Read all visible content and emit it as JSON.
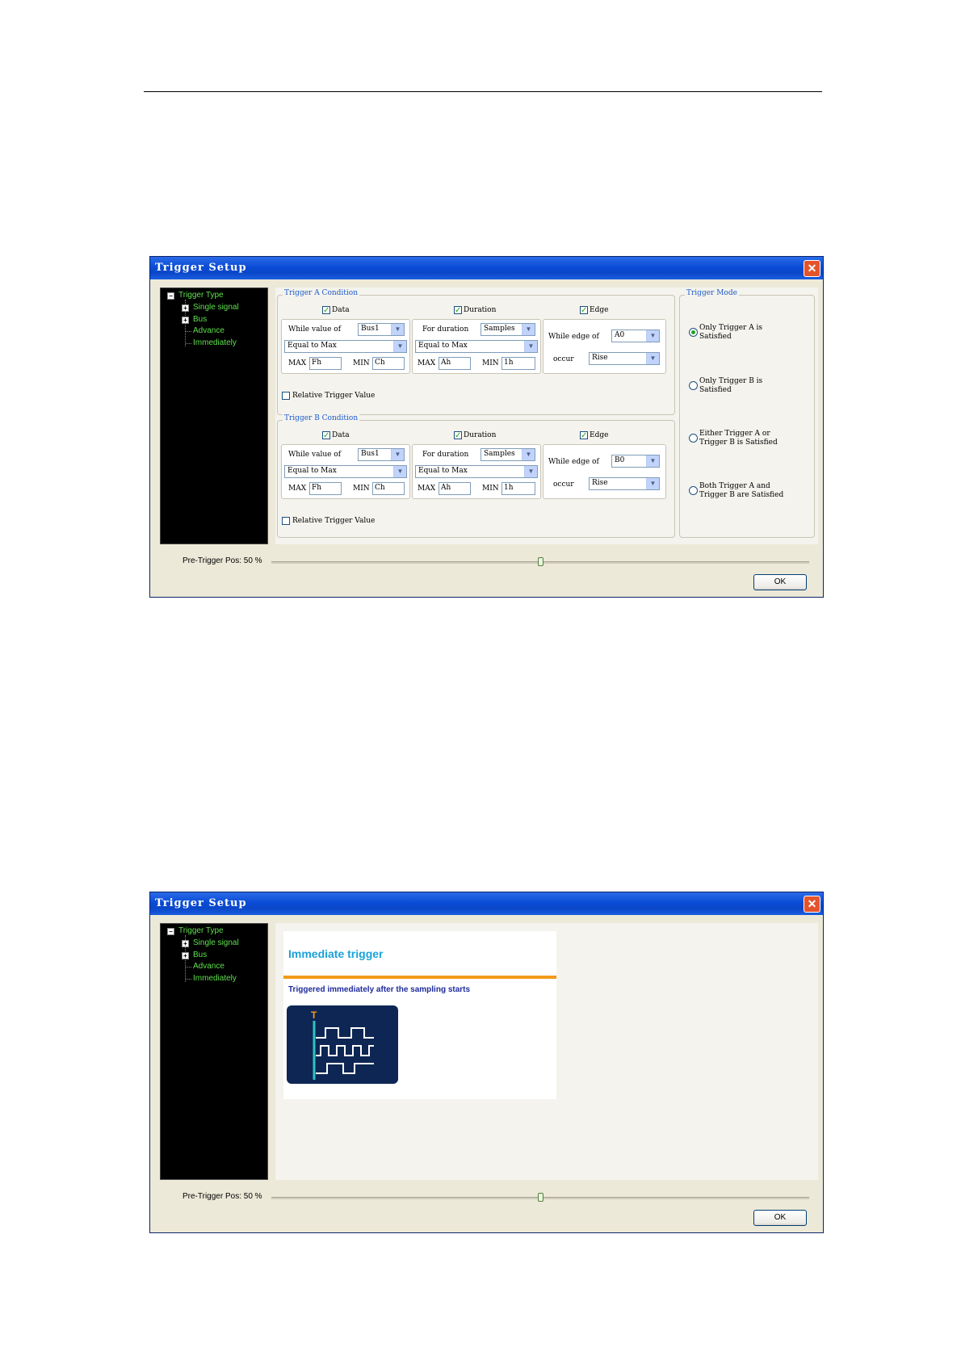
{
  "dialog1": {
    "title": "Trigger Setup",
    "close_glyph": "✕",
    "tree": {
      "root": "Trigger Type",
      "items": [
        "Single signal",
        "Bus",
        "Advance",
        "Immediately"
      ]
    },
    "trigger_a": {
      "title": "Trigger A Condition",
      "data_label": "Data",
      "duration_label": "Duration",
      "edge_label": "Edge",
      "while_value_label": "While value of",
      "while_value": "Bus1",
      "equal_select": "Equal to Max",
      "max_label": "MAX",
      "max_value": "Fh",
      "min_label": "MIN",
      "min_value": "Ch",
      "for_duration_label": "For duration",
      "duration_unit": "Samples",
      "dur_equal_select": "Equal to Max",
      "dur_max_label": "MAX",
      "dur_max_value": "Ah",
      "dur_min_label": "MIN",
      "dur_min_value": "1h",
      "while_edge_label": "While edge of",
      "edge_signal": "A0",
      "occur_label": "occur",
      "occur_value": "Rise",
      "relative_label": "Relative Trigger Value"
    },
    "trigger_b": {
      "title": "Trigger B Condition",
      "data_label": "Data",
      "duration_label": "Duration",
      "edge_label": "Edge",
      "while_value_label": "While value of",
      "while_value": "Bus1",
      "equal_select": "Equal to Max",
      "max_label": "MAX",
      "max_value": "Fh",
      "min_label": "MIN",
      "min_value": "Ch",
      "for_duration_label": "For duration",
      "duration_unit": "Samples",
      "dur_equal_select": "Equal to Max",
      "dur_max_label": "MAX",
      "dur_max_value": "Ah",
      "dur_min_label": "MIN",
      "dur_min_value": "1h",
      "while_edge_label": "While edge of",
      "edge_signal": "B0",
      "occur_label": "occur",
      "occur_value": "Rise",
      "relative_label": "Relative Trigger Value"
    },
    "mode": {
      "title": "Trigger Mode",
      "options": [
        {
          "line1": "Only Trigger A is",
          "line2": "Satisfied",
          "selected": true
        },
        {
          "line1": "Only Trigger B is",
          "line2": "Satisfied",
          "selected": false
        },
        {
          "line1": "Either Trigger A or",
          "line2": "Trigger B is Satisfied",
          "selected": false
        },
        {
          "line1": "Both Trigger A and",
          "line2": "Trigger B are Satisfied",
          "selected": false
        }
      ]
    },
    "pre_trigger_label": "Pre-Trigger Pos: 50 %",
    "pre_trigger_fraction": 0.5,
    "ok_label": "OK",
    "check_glyph": "✓",
    "arrow_glyph": "▼"
  },
  "dialog2": {
    "title": "Trigger Setup",
    "close_glyph": "✕",
    "tree": {
      "root": "Trigger Type",
      "items": [
        "Single signal",
        "Bus",
        "Advance",
        "Immediately"
      ]
    },
    "immediate": {
      "heading": "Immediate trigger",
      "description": "Triggered immediately after the sampling starts",
      "marker": "T"
    },
    "pre_trigger_label": "Pre-Trigger Pos: 50 %",
    "pre_trigger_fraction": 0.5,
    "ok_label": "OK"
  },
  "colors": {
    "title_bar": "#0a4cd6",
    "tree_text": "#5ee04c",
    "group_title": "#1c5ac8",
    "immediate_heading": "#1ba1d9",
    "immediate_bar": "#f29a18",
    "immediate_desc": "#1e2b9c"
  },
  "icons": [
    "close-icon",
    "checkbox-checked-icon",
    "dropdown-arrow-icon",
    "radio-icon",
    "tree-expand-icon",
    "waveform-icon"
  ]
}
